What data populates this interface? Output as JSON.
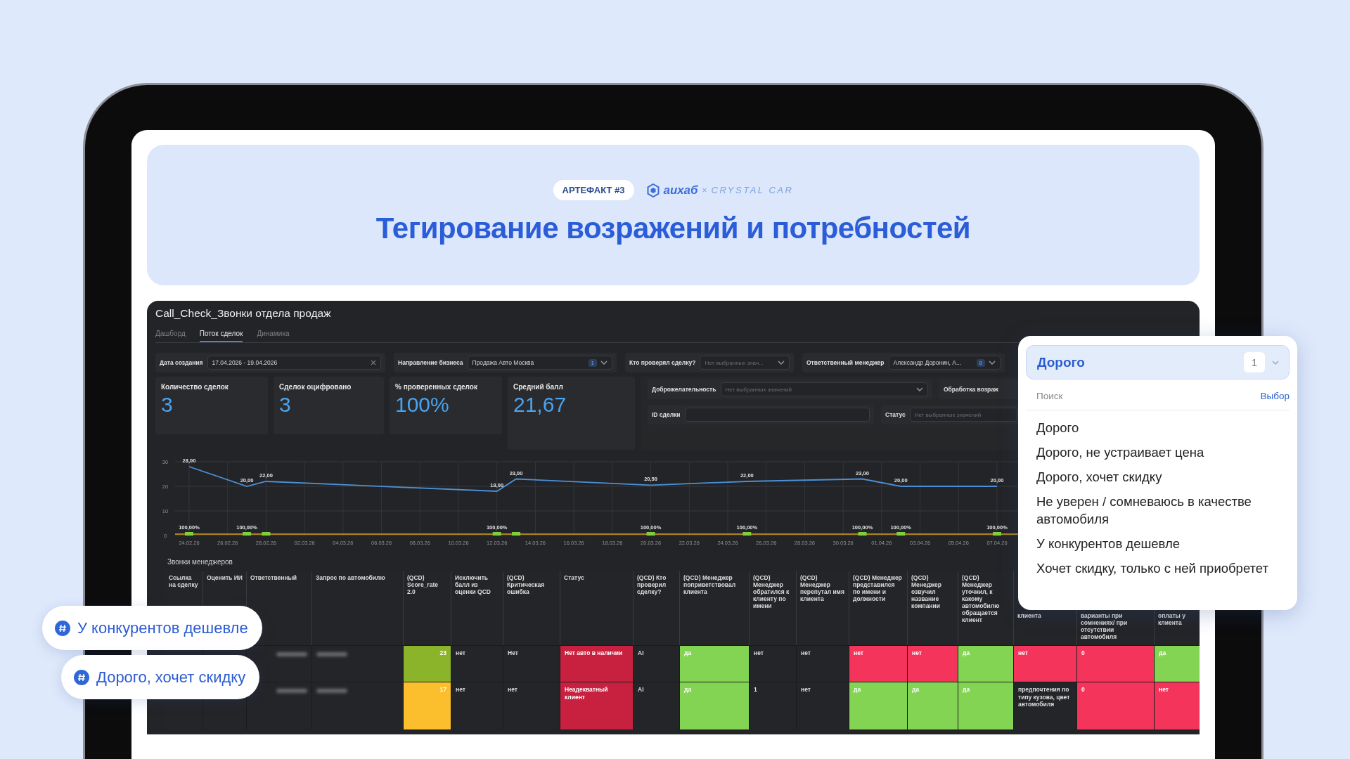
{
  "header": {
    "badge": "АРТЕФАКТ #3",
    "logo": {
      "brand": "аихаб",
      "separator": "×",
      "partner": "CRYSTAL CAR"
    },
    "title": "Тегирование возражений и потребностей"
  },
  "dashboard": {
    "title": "Call_Check_Звонки отдела продаж",
    "tabs": [
      {
        "label": "Дашборд",
        "selected": false
      },
      {
        "label": "Поток сделок",
        "selected": true
      },
      {
        "label": "Динамика",
        "selected": false
      }
    ],
    "filters": [
      {
        "label": "Дата создания",
        "kind": "date",
        "value": "17.04.2026 - 19.04.2026"
      },
      {
        "label": "Направление бизнеса",
        "kind": "select",
        "value": "Продажа Авто Москва",
        "count": "1"
      },
      {
        "label": "Кто проверял сделку?",
        "kind": "select",
        "placeholder": "Нет выбранных знач..."
      },
      {
        "label": "Ответственный менеджер",
        "kind": "select",
        "value": "Александр Доронин, А...",
        "count": "8"
      }
    ],
    "kpis": [
      {
        "label": "Количество сделок",
        "value": "3"
      },
      {
        "label": "Сделок оцифровано",
        "value": "3"
      },
      {
        "label": "% проверенных сделок",
        "value": "100%"
      },
      {
        "label": "Средний балл",
        "value": "21,67"
      }
    ],
    "side_filters": [
      [
        {
          "label": "Доброжелательность",
          "kind": "select",
          "placeholder": "Нет выбранных значений"
        },
        {
          "label": "Обработка возраж",
          "kind": "label"
        }
      ],
      [
        {
          "label": "ID сделки",
          "kind": "text"
        },
        {
          "label": "Статус",
          "kind": "text",
          "placeholder": "Нет выбранных значений"
        }
      ]
    ],
    "chart": {
      "chart_data": {
        "type": "line",
        "categories": [
          "24.02.26",
          null,
          "26.02.26",
          null,
          "28.02.26",
          null,
          "02.03.26",
          null,
          "04.03.26",
          null,
          "06.03.26",
          null,
          "08.03.26",
          null,
          "10.03.26",
          null,
          "12.03.26",
          null,
          "14.03.26",
          null,
          "16.03.26",
          null,
          "18.03.26",
          null,
          "20.03.26",
          null,
          "22.03.26",
          null,
          "24.03.26",
          null,
          "26.03.26",
          null,
          "28.03.26",
          null,
          "30.03.26",
          null,
          "01.04.26",
          null,
          "03.04.26",
          null,
          "05.04.26",
          null,
          "07.04.26"
        ],
        "series": [
          {
            "color": "#4d8fd6",
            "values": [
              28,
              null,
              null,
              20,
              22,
              null,
              null,
              null,
              null,
              null,
              null,
              null,
              null,
              null,
              null,
              null,
              18,
              23,
              null,
              null,
              null,
              null,
              null,
              null,
              20.5,
              null,
              null,
              null,
              null,
              22,
              null,
              null,
              null,
              null,
              null,
              23,
              null,
              20,
              null,
              null,
              null,
              null,
              20
            ]
          }
        ],
        "ylim": [
          0,
          30
        ],
        "yticks": [
          0,
          10,
          20,
          30
        ],
        "grid": true,
        "value_labels": [
          "28,00",
          null,
          null,
          "20,00",
          "22,00",
          null,
          null,
          null,
          null,
          null,
          null,
          null,
          null,
          null,
          null,
          null,
          "18,00",
          "23,00",
          null,
          null,
          null,
          null,
          null,
          null,
          "20,50",
          null,
          null,
          null,
          null,
          "22,00",
          null,
          null,
          null,
          null,
          null,
          "23,00",
          null,
          "20,00",
          null,
          null,
          null,
          null,
          "20,00"
        ]
      },
      "percent_markers": [
        {
          "marker": true,
          "label": "100,00%"
        },
        {
          "marker": true,
          "label": "100,00%"
        },
        {
          "marker": true
        },
        {
          "marker": true,
          "label": "100,00%"
        },
        {
          "marker": true
        },
        {
          "marker": true,
          "label": "100,00%"
        },
        {
          "marker": true,
          "label": "100,00%"
        },
        {
          "marker": true,
          "label": "100,00%"
        },
        {
          "marker": true,
          "label": "100,00%"
        },
        {
          "marker": true,
          "label": "100,00%"
        }
      ]
    },
    "table": {
      "title": "Звонки менеджеров",
      "columns": [
        "Ссылка на сделку",
        "Оценить ИИ",
        "Ответственный",
        "Запрос по автомобилю",
        "(QCD) Score_rate 2.0",
        "Исключить балл из оценки QCD",
        "(QCD) Критическая ошибка",
        "Статус",
        "(QCD) Кто проверил сделку?",
        "(QCD) Менеджер поприветствовал клиента",
        "(QCD) Менеджер обратился к клиенту по имени",
        "(QCD) Менеджер перепутал имя клиента",
        "(QCD) Менеджер представился по имени и должности",
        "(QCD) Менеджер озвучил название компании",
        "(QCD) Менеджер уточнил, к какому автомобилю обращается клиент",
        "клиента",
        "варианты при сомнениях/ при отсутствии автомобиля",
        "оплаты у клиента"
      ],
      "rows": [
        {
          "cells": [
            {
              "kind": "empty"
            },
            {
              "kind": "empty"
            },
            {
              "kind": "blurred"
            },
            {
              "kind": "blurred"
            },
            {
              "kind": "number",
              "text": "23",
              "color": "#8bb42a"
            },
            {
              "kind": "text",
              "text": "нет"
            },
            {
              "kind": "text",
              "text": "Нет"
            },
            {
              "kind": "text",
              "text": "Нет авто в наличии",
              "color": "#c8213f"
            },
            {
              "kind": "text",
              "text": "AI"
            },
            {
              "kind": "text",
              "text": "да",
              "color": "#84d454"
            },
            {
              "kind": "text",
              "text": "нет"
            },
            {
              "kind": "text",
              "text": "нет"
            },
            {
              "kind": "text",
              "text": "нет",
              "color": "#f5345c"
            },
            {
              "kind": "text",
              "text": "нет",
              "color": "#f5345c"
            },
            {
              "kind": "text",
              "text": "да",
              "color": "#84d454"
            },
            {
              "kind": "text",
              "text": "нет",
              "color": "#f5345c"
            },
            {
              "kind": "text",
              "text": "0",
              "color": "#f5345c"
            },
            {
              "kind": "text",
              "text": "да",
              "color": "#84d454"
            }
          ]
        },
        {
          "cells": [
            {
              "kind": "empty"
            },
            {
              "kind": "empty"
            },
            {
              "kind": "blurred"
            },
            {
              "kind": "blurred"
            },
            {
              "kind": "number",
              "text": "17",
              "color": "#fbbf2e"
            },
            {
              "kind": "text",
              "text": "нет"
            },
            {
              "kind": "text",
              "text": "нет"
            },
            {
              "kind": "text",
              "text": "Неадекватный клиент",
              "color": "#c8213f"
            },
            {
              "kind": "text",
              "text": "AI"
            },
            {
              "kind": "text",
              "text": "да",
              "color": "#84d454"
            },
            {
              "kind": "text",
              "text": "1"
            },
            {
              "kind": "text",
              "text": "нет"
            },
            {
              "kind": "text",
              "text": "да",
              "color": "#84d454"
            },
            {
              "kind": "text",
              "text": "да",
              "color": "#84d454"
            },
            {
              "kind": "text",
              "text": "да",
              "color": "#84d454"
            },
            {
              "kind": "text",
              "text": "предпочтения по типу кузова, цвет автомобиля"
            },
            {
              "kind": "text",
              "text": "0",
              "color": "#f5345c"
            },
            {
              "kind": "text",
              "text": "нет",
              "color": "#f5345c"
            }
          ]
        }
      ]
    }
  },
  "dropdown": {
    "value": "Дорого",
    "count": "1",
    "search_placeholder": "Поиск",
    "action": "Выбор",
    "options": [
      "Дорого",
      "Дорого, не устраивает цена",
      "Дорого, хочет скидку",
      "Не уверен / сомневаюсь в качестве автомобиля",
      "У конкурентов дешевле",
      "Хочет скидку, только с ней приобретет"
    ]
  },
  "tags": [
    {
      "label": "У конкурентов дешевле"
    },
    {
      "label": "Дорого, хочет скидку"
    }
  ]
}
